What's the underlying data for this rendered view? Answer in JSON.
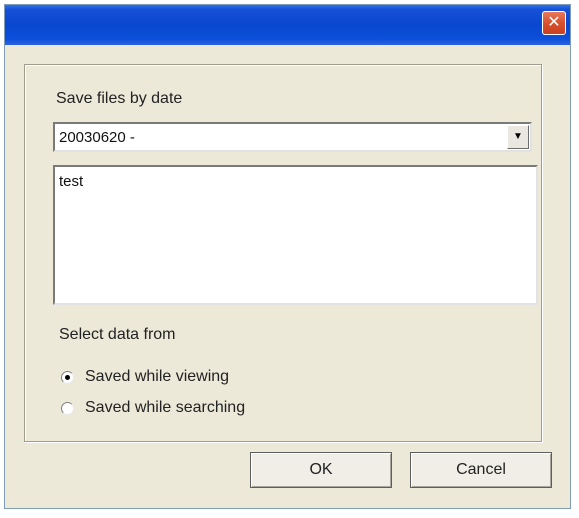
{
  "window": {
    "close_glyph": "✕"
  },
  "save_by_date": {
    "label": "Save files by date",
    "selected": "20030620 -",
    "dropdown_arrow": "▼"
  },
  "file_list": {
    "items": [
      "test"
    ]
  },
  "data_source": {
    "label": "Select data from",
    "options": [
      {
        "label": "Saved while viewing",
        "checked": true
      },
      {
        "label": "Saved while searching",
        "checked": false
      }
    ]
  },
  "buttons": {
    "ok": "OK",
    "cancel": "Cancel"
  },
  "colors": {
    "titlebar": "#0a47d0",
    "close_button": "#d8512f",
    "dialog_bg": "#ece9d8"
  }
}
